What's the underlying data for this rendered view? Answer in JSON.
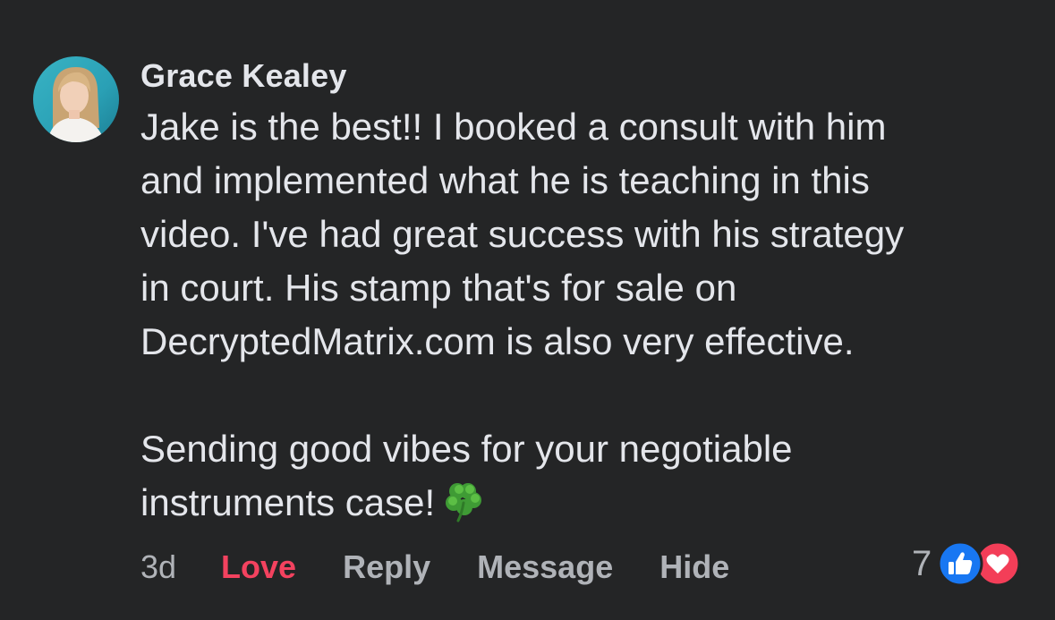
{
  "comment": {
    "author": "Grace Kealey",
    "lines": [
      "Jake is the best!! I booked a consult with him",
      "and implemented what he is teaching in this",
      "video. I've had great success with his strategy",
      "in court. His stamp that's for sale on",
      "DecryptedMatrix.com is also very effective.",
      "Sending good vibes for your negotiable",
      "instruments case!"
    ],
    "emoji": "four-leaf-clover"
  },
  "actions": {
    "time": "3d",
    "love": "Love",
    "reply": "Reply",
    "message": "Message",
    "hide": "Hide"
  },
  "reactions": {
    "count": "7",
    "icons": [
      "like-icon",
      "heart-icon"
    ]
  },
  "colors": {
    "background": "#242526",
    "text": "#e4e6eb",
    "secondary": "#b0b3b8",
    "love": "#f3425f",
    "like_blue": "#1877f2",
    "heart_red": "#f33e58"
  }
}
